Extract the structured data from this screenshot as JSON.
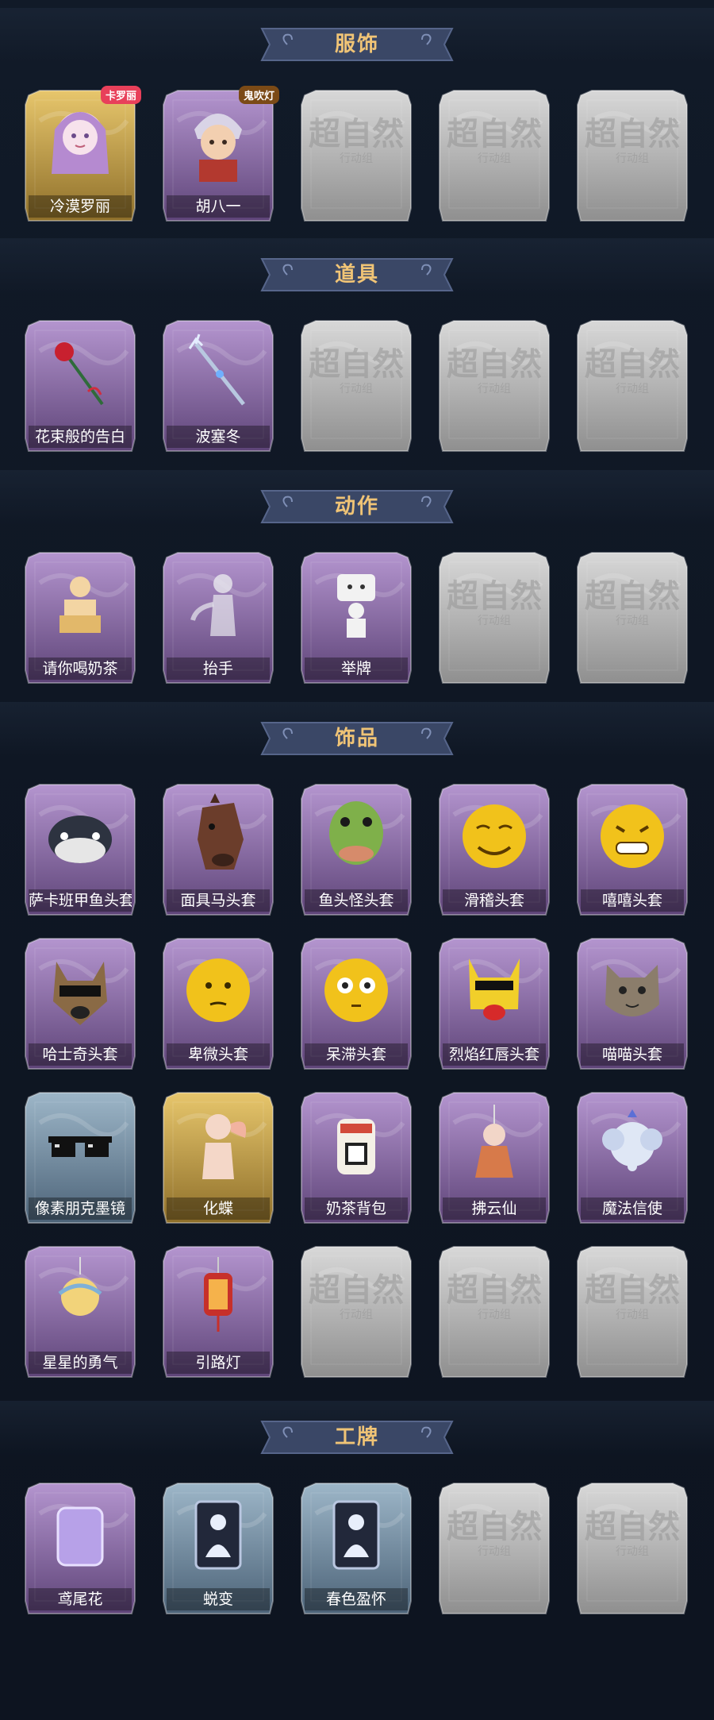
{
  "sections": [
    {
      "title": "服饰",
      "items": [
        {
          "name": "冷漠罗丽",
          "rarity": "gold",
          "icon": "doll-portrait-icon",
          "badge": "卡罗丽"
        },
        {
          "name": "胡八一",
          "rarity": "purple",
          "icon": "young-man-portrait-icon",
          "badge": "鬼吹灯"
        },
        {
          "name": "",
          "rarity": "locked",
          "icon": "locked-placeholder-icon"
        },
        {
          "name": "",
          "rarity": "locked",
          "icon": "locked-placeholder-icon"
        },
        {
          "name": "",
          "rarity": "locked",
          "icon": "locked-placeholder-icon"
        }
      ]
    },
    {
      "title": "道具",
      "items": [
        {
          "name": "花束般的告白",
          "rarity": "purple",
          "icon": "rose-icon"
        },
        {
          "name": "波塞冬",
          "rarity": "purple",
          "icon": "trident-icon"
        },
        {
          "name": "",
          "rarity": "locked",
          "icon": "locked-placeholder-icon"
        },
        {
          "name": "",
          "rarity": "locked",
          "icon": "locked-placeholder-icon"
        },
        {
          "name": "",
          "rarity": "locked",
          "icon": "locked-placeholder-icon"
        }
      ]
    },
    {
      "title": "动作",
      "items": [
        {
          "name": "请你喝奶茶",
          "rarity": "purple",
          "icon": "offer-drink-icon"
        },
        {
          "name": "抬手",
          "rarity": "purple",
          "icon": "raise-hand-icon"
        },
        {
          "name": "举牌",
          "rarity": "purple",
          "icon": "hold-sign-icon"
        },
        {
          "name": "",
          "rarity": "locked",
          "icon": "locked-placeholder-icon"
        },
        {
          "name": "",
          "rarity": "locked",
          "icon": "locked-placeholder-icon"
        }
      ]
    },
    {
      "title": "饰品",
      "items": [
        {
          "name": "萨卡班甲鱼头套",
          "rarity": "purple",
          "icon": "fish-mask-icon"
        },
        {
          "name": "面具马头套",
          "rarity": "purple",
          "icon": "horse-mask-icon"
        },
        {
          "name": "鱼头怪头套",
          "rarity": "purple",
          "icon": "fishhead-mask-icon"
        },
        {
          "name": "滑稽头套",
          "rarity": "purple",
          "icon": "funny-face-icon"
        },
        {
          "name": "嘻嘻头套",
          "rarity": "purple",
          "icon": "grin-face-icon"
        },
        {
          "name": "哈士奇头套",
          "rarity": "purple",
          "icon": "husky-mask-icon"
        },
        {
          "name": "卑微头套",
          "rarity": "purple",
          "icon": "humble-face-icon"
        },
        {
          "name": "呆滞头套",
          "rarity": "purple",
          "icon": "dazed-face-icon"
        },
        {
          "name": "烈焰红唇头套",
          "rarity": "purple",
          "icon": "pikachu-mask-icon"
        },
        {
          "name": "喵喵头套",
          "rarity": "purple",
          "icon": "cat-mask-icon"
        },
        {
          "name": "像素朋克墨镜",
          "rarity": "blue",
          "icon": "pixel-sunglasses-icon"
        },
        {
          "name": "化蝶",
          "rarity": "gold",
          "icon": "butterfly-figure-icon"
        },
        {
          "name": "奶茶背包",
          "rarity": "purple",
          "icon": "milk-tea-backpack-icon"
        },
        {
          "name": "拂云仙",
          "rarity": "purple",
          "icon": "fairy-pendant-icon"
        },
        {
          "name": "魔法信使",
          "rarity": "purple",
          "icon": "elephant-messenger-icon"
        },
        {
          "name": "星星的勇气",
          "rarity": "purple",
          "icon": "star-charm-icon"
        },
        {
          "name": "引路灯",
          "rarity": "purple",
          "icon": "lantern-icon"
        },
        {
          "name": "",
          "rarity": "locked",
          "icon": "locked-placeholder-icon"
        },
        {
          "name": "",
          "rarity": "locked",
          "icon": "locked-placeholder-icon"
        },
        {
          "name": "",
          "rarity": "locked",
          "icon": "locked-placeholder-icon"
        }
      ]
    },
    {
      "title": "工牌",
      "items": [
        {
          "name": "鸢尾花",
          "rarity": "purple",
          "icon": "iris-badge-icon"
        },
        {
          "name": "蜕变",
          "rarity": "blue",
          "icon": "silhouette-card-icon"
        },
        {
          "name": "春色盈怀",
          "rarity": "blue",
          "icon": "silhouette-card-icon"
        },
        {
          "name": "",
          "rarity": "locked",
          "icon": "locked-placeholder-icon"
        },
        {
          "name": "",
          "rarity": "locked",
          "icon": "locked-placeholder-icon"
        }
      ]
    }
  ],
  "locked_watermark": {
    "main": "超自然",
    "sub": "行动组"
  },
  "colors": {
    "background": "#0e1522",
    "banner": "#3a4766",
    "banner_text": "#f0c476",
    "purple": "#8a6aa8",
    "gold": "#c9a24a",
    "blue": "#6f8fa6",
    "locked": "#b9b9b9"
  }
}
